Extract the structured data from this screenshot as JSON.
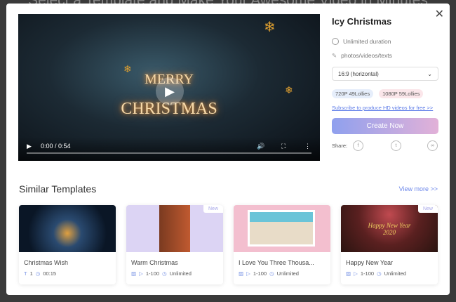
{
  "background": {
    "title": "Select a Template and Make Your Awesome Video in Minutes"
  },
  "video": {
    "line1": "MERRY",
    "line2": "CHRISTMAS",
    "time": "0:00 / 0:54"
  },
  "details": {
    "title": "Icy Christmas",
    "duration": "Unlimited duration",
    "media": "photos/videos/texts",
    "aspect": "16:9 (horizontal)",
    "badge_720": "720P 49Lollies",
    "badge_1080": "1080P 59Lollies",
    "subscribe": "Subscribe to produce HD videos for free >>",
    "create": "Create Now",
    "share_label": "Share:"
  },
  "similar": {
    "title": "Similar Templates",
    "view_more": "View more >>",
    "cards": [
      {
        "title": "Christmas Wish",
        "a": "1",
        "b": "00:15",
        "new": ""
      },
      {
        "title": "Warm Christmas",
        "a": "1-100",
        "b": "Unlimited",
        "new": "New"
      },
      {
        "title": "I Love You Three Thousa...",
        "a": "1-100",
        "b": "Unlimited",
        "new": ""
      },
      {
        "title": "Happy New Year",
        "a": "1-100",
        "b": "Unlimited",
        "new": "New",
        "thumb_text": "Happy New Year 2020"
      }
    ]
  },
  "colors": {
    "accent": "#6b86ea",
    "create_start": "#8fa0ee",
    "create_end": "#e2b1d8"
  }
}
